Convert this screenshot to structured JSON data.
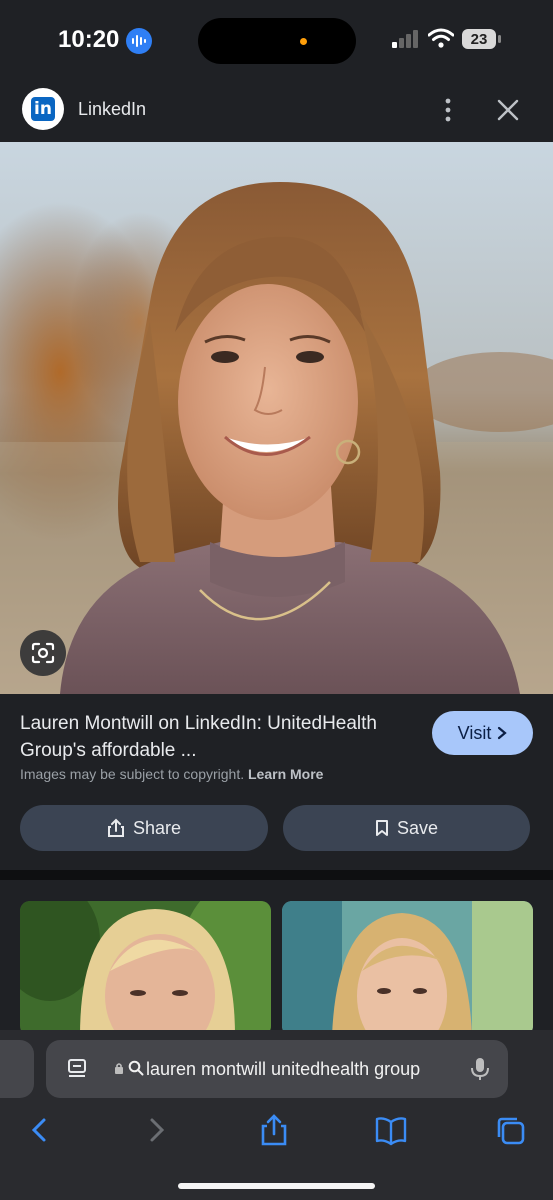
{
  "status_bar": {
    "time": "10:20",
    "battery": "23"
  },
  "header": {
    "site_logo_text": "in",
    "site_name": "LinkedIn"
  },
  "result": {
    "title": "Lauren Montwill on LinkedIn: UnitedHealth Group's affordable ...",
    "visit_label": "Visit",
    "copyright_text": "Images may be subject to copyright.",
    "learn_more_label": "Learn More",
    "share_label": "Share",
    "save_label": "Save"
  },
  "browser": {
    "url_text": "lauren montwill unitedhealth group"
  },
  "colors": {
    "background": "#1f2125",
    "accent_button": "#a8c7fa",
    "pill_button": "#3b4453",
    "ios_blue": "#3b8cf5",
    "linkedin_blue": "#0a66c2"
  }
}
